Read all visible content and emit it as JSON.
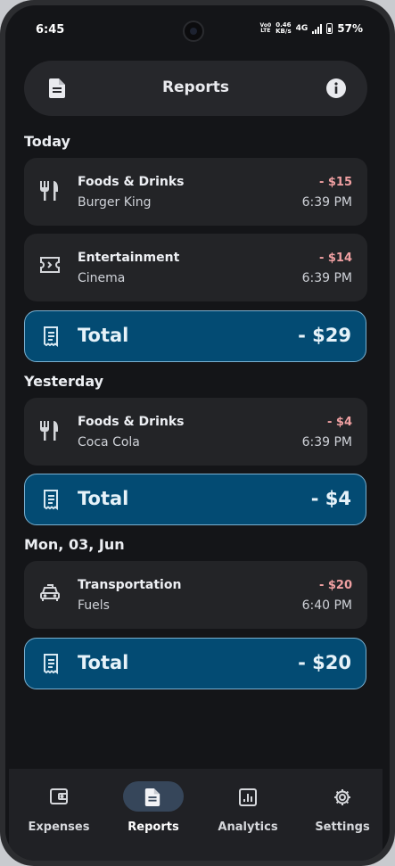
{
  "status_bar": {
    "time": "6:45",
    "volte": [
      "Vo0",
      "LTE"
    ],
    "net_speed": [
      "0.46",
      "KB/s"
    ],
    "network": "4G",
    "battery": "57%"
  },
  "header": {
    "title": "Reports",
    "left_icon": "document-icon",
    "right_icon": "info-icon"
  },
  "groups": [
    {
      "label": "Today",
      "items": [
        {
          "icon": "fork-knife-icon",
          "category": "Foods & Drinks",
          "name": "Burger King",
          "amount": "- $15",
          "time": "6:39 PM"
        },
        {
          "icon": "ticket-icon",
          "category": "Entertainment",
          "name": "Cinema",
          "amount": "- $14",
          "time": "6:39 PM"
        }
      ],
      "total_label": "Total",
      "total": "- $29"
    },
    {
      "label": "Yesterday",
      "items": [
        {
          "icon": "fork-knife-icon",
          "category": "Foods & Drinks",
          "name": "Coca Cola",
          "amount": "- $4",
          "time": "6:39 PM"
        }
      ],
      "total_label": "Total",
      "total": "- $4"
    },
    {
      "label": "Mon, 03, Jun",
      "items": [
        {
          "icon": "taxi-icon",
          "category": "Transportation",
          "name": "Fuels",
          "amount": "- $20",
          "time": "6:40 PM"
        }
      ],
      "total_label": "Total",
      "total": "- $20"
    }
  ],
  "nav": {
    "items": [
      {
        "label": "Expenses",
        "icon": "wallet-icon",
        "active": false
      },
      {
        "label": "Reports",
        "icon": "document-icon",
        "active": true
      },
      {
        "label": "Analytics",
        "icon": "chart-icon",
        "active": false
      },
      {
        "label": "Settings",
        "icon": "gear-icon",
        "active": false
      }
    ]
  },
  "colors": {
    "background": "#141518",
    "card": "#232427",
    "total_card": "#034b73",
    "amount_negative": "#f0a0a2"
  }
}
